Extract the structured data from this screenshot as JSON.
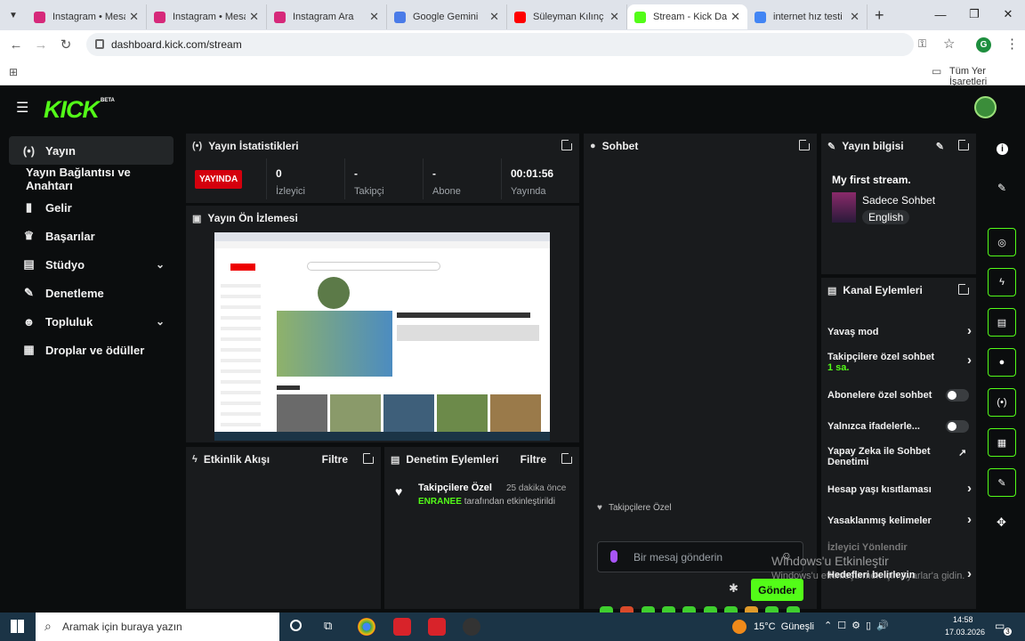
{
  "browser": {
    "tabs": [
      {
        "label": "Instagram • Mesaj",
        "color": "#d6297a"
      },
      {
        "label": "Instagram • Mesaj",
        "color": "#d6297a"
      },
      {
        "label": "Instagram Ara",
        "color": "#d6297a"
      },
      {
        "label": "Google Gemini",
        "color": "#4a7be8"
      },
      {
        "label": "Süleyman Kılınç - Y",
        "color": "#ff0000"
      },
      {
        "label": "Stream - Kick Das",
        "color": "#53fc18"
      },
      {
        "label": "internet hız testi",
        "color": "#4285f4"
      }
    ],
    "url": "dashboard.kick.com/stream",
    "bookmarks_label": "Tüm Yer İşaretleri",
    "profile_initial": "G"
  },
  "kick": {
    "logo": "KICK",
    "logo_badge": "BETA",
    "sidebar": [
      {
        "label": "Yayın",
        "icon": "broadcast-icon",
        "glyph": "(•)"
      },
      {
        "label": "Yayın Bağlantısı ve Anahtarı",
        "icon": "",
        "glyph": ""
      },
      {
        "label": "Gelir",
        "icon": "chart-icon",
        "glyph": "▮"
      },
      {
        "label": "Başarılar",
        "icon": "trophy-icon",
        "glyph": "♛"
      },
      {
        "label": "Stüdyo",
        "icon": "studio-icon",
        "glyph": "▤"
      },
      {
        "label": "Denetleme",
        "icon": "wrench-icon",
        "glyph": "✎"
      },
      {
        "label": "Topluluk",
        "icon": "people-icon",
        "glyph": "☻"
      },
      {
        "label": "Droplar ve ödüller",
        "icon": "gift-icon",
        "glyph": "▦"
      }
    ],
    "stats_panel": {
      "title": "Yayın İstatistikleri",
      "live_badge": "YAYINDA",
      "stats": [
        {
          "value": "0",
          "label": "İzleyici"
        },
        {
          "value": "-",
          "label": "Takipçi"
        },
        {
          "value": "-",
          "label": "Abone"
        },
        {
          "value": "00:01:56",
          "label": "Yayında"
        }
      ]
    },
    "preview_panel": {
      "title": "Yayın Ön İzlemesi"
    },
    "activity_panel": {
      "title": "Etkinlik Akışı",
      "filter": "Filtre"
    },
    "moderation_panel": {
      "title": "Denetim Eylemleri",
      "filter": "Filtre",
      "entry_title": "Takipçilere Özel",
      "entry_time": "25 dakika önce",
      "entry_user": "ENRANEE",
      "entry_text": "tarafından etkinleştirildi"
    },
    "chat_panel": {
      "title": "Sohbet",
      "mode_label": "Takipçilere Özel",
      "input_placeholder": "Bir mesaj gönderin",
      "send_label": "Gönder"
    },
    "info_panel": {
      "title": "Yayın bilgisi",
      "stream_title": "My first stream.",
      "category": "Sadece Sohbet",
      "language": "English"
    },
    "channel_actions": {
      "title": "Kanal Eylemleri",
      "items": [
        {
          "label": "Yavaş mod",
          "sub": "",
          "control": "chevron"
        },
        {
          "label": "Takipçilere özel sohbet",
          "sub": "1 sa.",
          "control": "chevron"
        },
        {
          "label": "Abonelere özel sohbet",
          "sub": "",
          "control": "toggle"
        },
        {
          "label": "Yalnızca ifadelerle...",
          "sub": "",
          "control": "toggle"
        },
        {
          "label": "Yapay Zeka ile Sohbet Denetimi",
          "sub": "",
          "control": "external"
        },
        {
          "label": "Hesap yaşı kısıtlaması",
          "sub": "",
          "control": "chevron"
        },
        {
          "label": "Yasaklanmış kelimeler",
          "sub": "",
          "control": "chevron"
        },
        {
          "label": "İzleyici Yönlendir",
          "sub": "",
          "control": "none"
        },
        {
          "label": "Hedefleri belirleyin",
          "sub": "",
          "control": "chevron"
        }
      ]
    }
  },
  "watermark": {
    "line1": "Windows'u Etkinleştir",
    "line2": "Windows'u etkinleştirmek için Ayarlar'a gidin."
  },
  "taskbar": {
    "search_placeholder": "Aramak için buraya yazın",
    "weather": "15°C  Güneşli",
    "time": "14:58",
    "date": "17.03.2026",
    "notifications": "3"
  }
}
